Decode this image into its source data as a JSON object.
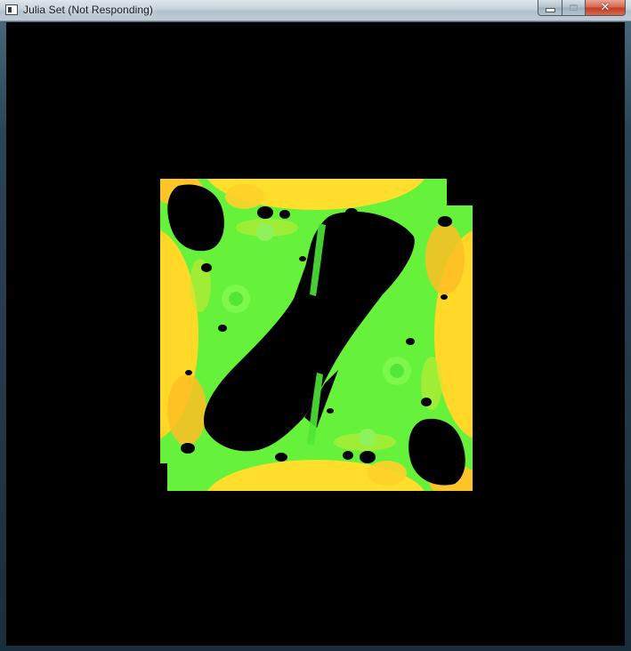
{
  "window": {
    "title": "Julia Set (Not Responding)",
    "icon": "app-window-icon"
  },
  "caption_buttons": {
    "minimize_icon": "minimize-icon",
    "maximize_icon": "maximize-icon",
    "close_icon": "close-icon",
    "close_label": "✕"
  },
  "canvas": {
    "background": "#000000",
    "palette": [
      "#ffd21e",
      "#ffb41e",
      "#f5a01e",
      "#5bf03a",
      "#7ff53c",
      "#000000"
    ]
  }
}
